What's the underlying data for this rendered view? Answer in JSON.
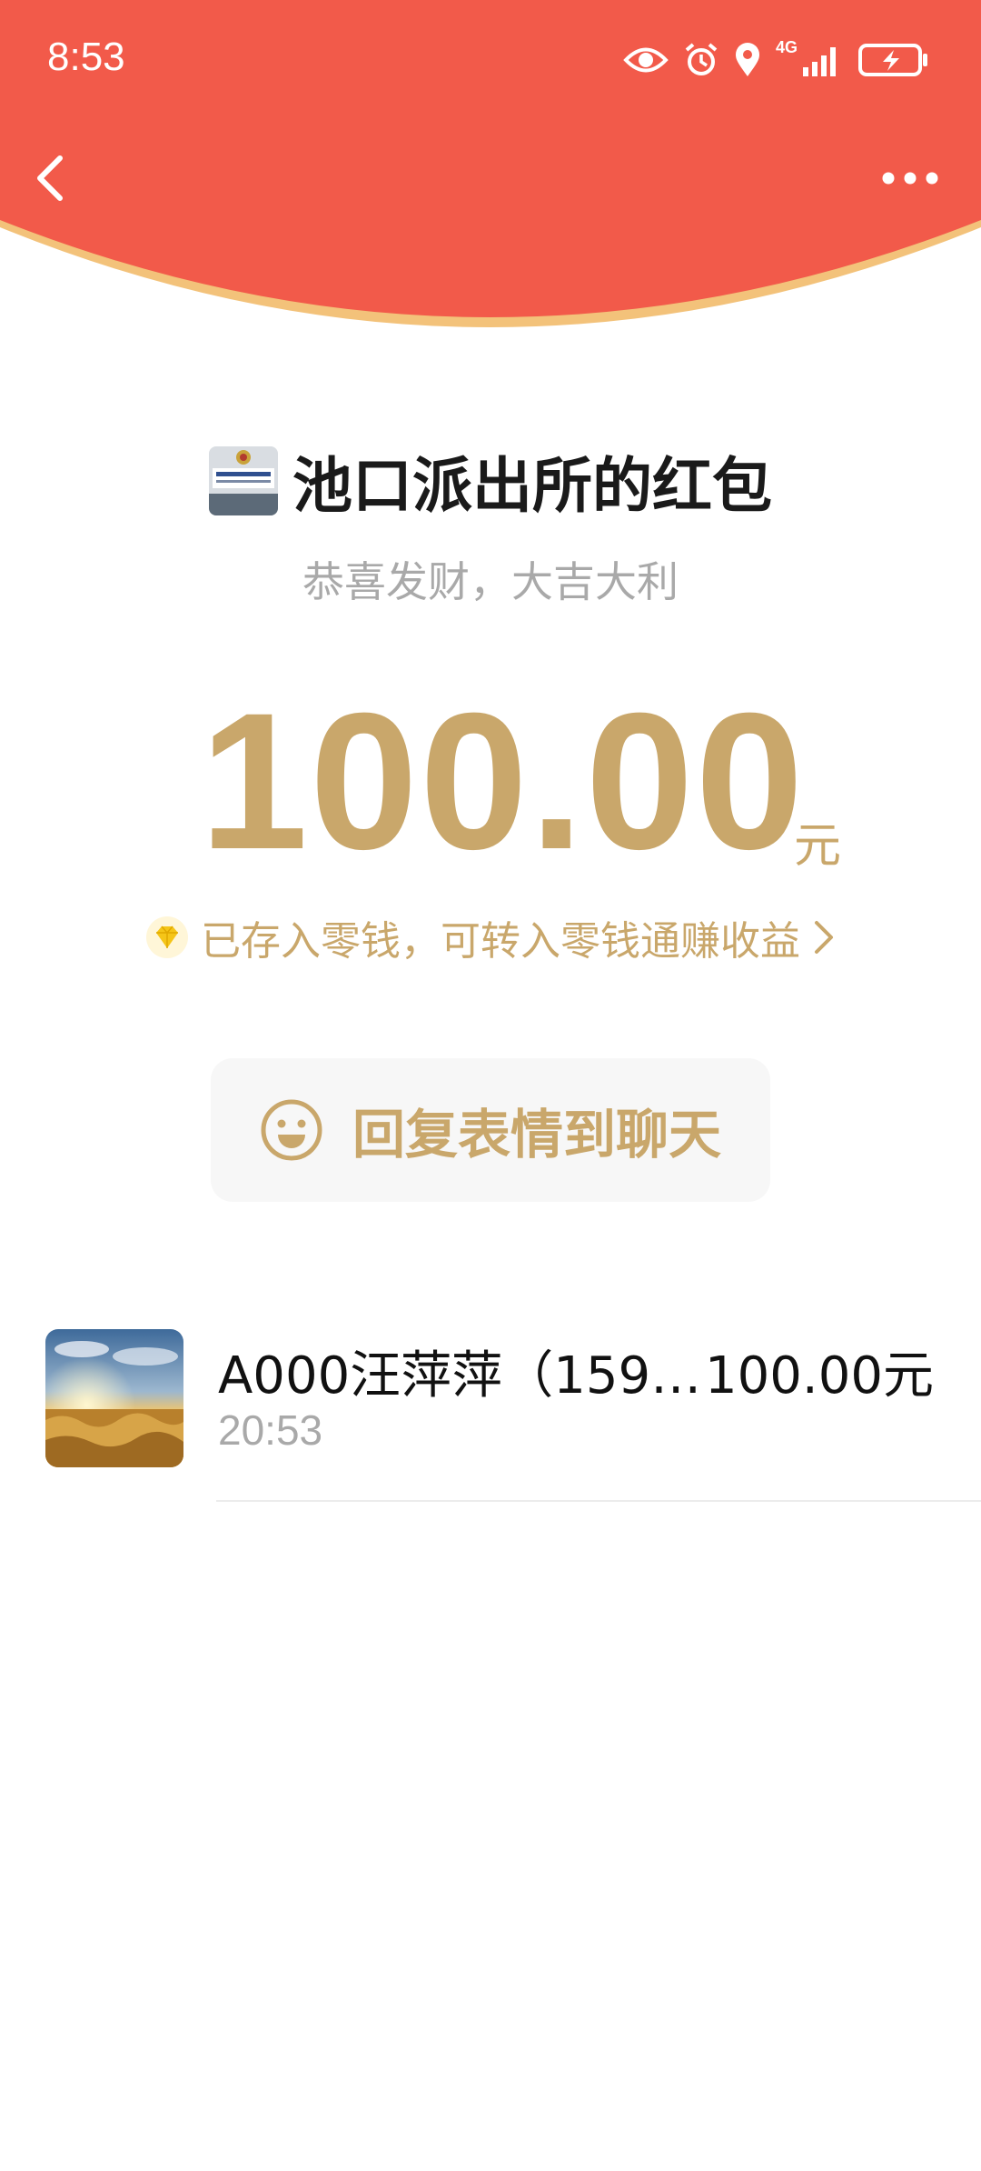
{
  "status_bar": {
    "time": "8:53",
    "network": "4G",
    "icons": [
      "eye-icon",
      "alarm-icon",
      "location-icon",
      "signal-icon",
      "battery-charging-icon"
    ]
  },
  "nav": {
    "back_icon": "chevron-left-icon",
    "more_icon": "more-dots-icon"
  },
  "red_packet": {
    "sender_title": "池口派出所的红包",
    "greeting": "恭喜发财，大吉大利",
    "amount": "100.00",
    "unit": "元",
    "saved_text": "已存入零钱，可转入零钱通赚收益",
    "reply_label": "回复表情到聊天"
  },
  "records": [
    {
      "name": "A000汪萍萍（159…",
      "amount": "100.00元",
      "time": "20:53"
    }
  ],
  "colors": {
    "header_red": "#f25a4a",
    "header_edge": "#f3c27a",
    "gold_text": "#c9a76b",
    "title_text": "#1a1a1a",
    "muted_text": "#a9a9a9",
    "button_bg": "#f7f7f7"
  }
}
